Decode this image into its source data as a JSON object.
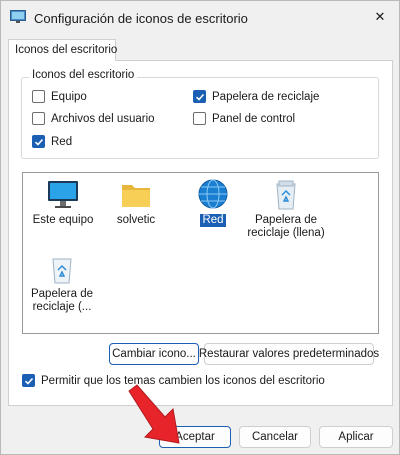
{
  "window": {
    "title": "Configuración de iconos de escritorio",
    "close_glyph": "✕"
  },
  "tab": {
    "label": "Iconos del escritorio"
  },
  "group": {
    "legend": "Iconos del escritorio",
    "checkboxes": [
      {
        "label": "Equipo",
        "checked": false
      },
      {
        "label": "Papelera de reciclaje",
        "checked": true
      },
      {
        "label": "Archivos del usuario",
        "checked": false
      },
      {
        "label": "Panel de control",
        "checked": false
      },
      {
        "label": "Red",
        "checked": true
      }
    ]
  },
  "icons": [
    {
      "label": "Este equipo",
      "icon": "monitor-icon",
      "selected": false
    },
    {
      "label": "solvetic",
      "icon": "folder-icon",
      "selected": false
    },
    {
      "label": "Red",
      "icon": "network-globe-icon",
      "selected": true
    },
    {
      "label": "Papelera de reciclaje (llena)",
      "icon": "recycle-bin-full-icon",
      "selected": false
    },
    {
      "label": "Papelera de reciclaje (...",
      "icon": "recycle-bin-empty-icon",
      "selected": false
    }
  ],
  "buttons": {
    "change_icon": "Cambiar icono...",
    "restore_defaults": "Restaurar valores predeterminados",
    "ok": "Aceptar",
    "cancel": "Cancelar",
    "apply": "Aplicar"
  },
  "themes_checkbox": {
    "label": "Permitir que los temas cambien los iconos del escritorio",
    "checked": true
  },
  "colors": {
    "accent": "#1a5fb4",
    "annotation_arrow": "#e8242b"
  }
}
